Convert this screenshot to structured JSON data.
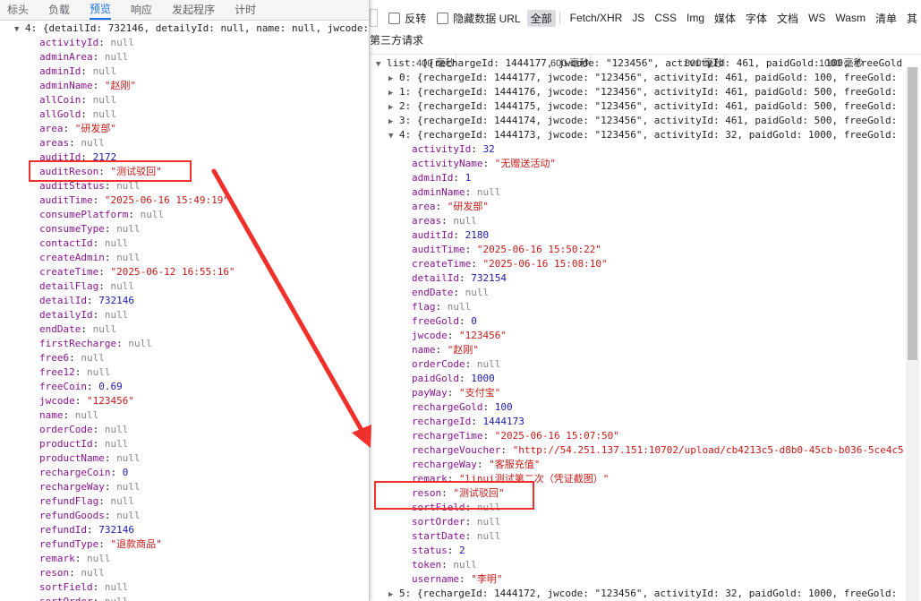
{
  "left_tabs": [
    {
      "label": "标头",
      "active": false
    },
    {
      "label": "负载",
      "active": false
    },
    {
      "label": "预览",
      "active": true
    },
    {
      "label": "响应",
      "active": false
    },
    {
      "label": "发起程序",
      "active": false
    },
    {
      "label": "计时",
      "active": false
    }
  ],
  "left_header": "4: {detailId: 732146, detailyId: null, name: null, jwcode: \"123456\"",
  "left_props": [
    {
      "k": "activityId",
      "v": "null",
      "t": "nul"
    },
    {
      "k": "adminArea",
      "v": "null",
      "t": "nul"
    },
    {
      "k": "adminId",
      "v": "null",
      "t": "nul"
    },
    {
      "k": "adminName",
      "v": "\"赵刚\"",
      "t": "str"
    },
    {
      "k": "allCoin",
      "v": "null",
      "t": "nul"
    },
    {
      "k": "allGold",
      "v": "null",
      "t": "nul"
    },
    {
      "k": "area",
      "v": "\"研发部\"",
      "t": "str"
    },
    {
      "k": "areas",
      "v": "null",
      "t": "nul"
    },
    {
      "k": "auditId",
      "v": "2172",
      "t": "num"
    },
    {
      "k": "auditReson",
      "v": "\"测试驳回\"",
      "t": "str"
    },
    {
      "k": "auditStatus",
      "v": "null",
      "t": "nul"
    },
    {
      "k": "auditTime",
      "v": "\"2025-06-16 15:49:19\"",
      "t": "str"
    },
    {
      "k": "consumePlatform",
      "v": "null",
      "t": "nul"
    },
    {
      "k": "consumeType",
      "v": "null",
      "t": "nul"
    },
    {
      "k": "contactId",
      "v": "null",
      "t": "nul"
    },
    {
      "k": "createAdmin",
      "v": "null",
      "t": "nul"
    },
    {
      "k": "createTime",
      "v": "\"2025-06-12 16:55:16\"",
      "t": "str"
    },
    {
      "k": "detailFlag",
      "v": "null",
      "t": "nul"
    },
    {
      "k": "detailId",
      "v": "732146",
      "t": "num"
    },
    {
      "k": "detailyId",
      "v": "null",
      "t": "nul"
    },
    {
      "k": "endDate",
      "v": "null",
      "t": "nul"
    },
    {
      "k": "firstRecharge",
      "v": "null",
      "t": "nul"
    },
    {
      "k": "free6",
      "v": "null",
      "t": "nul"
    },
    {
      "k": "free12",
      "v": "null",
      "t": "nul"
    },
    {
      "k": "freeCoin",
      "v": "0.69",
      "t": "num"
    },
    {
      "k": "jwcode",
      "v": "\"123456\"",
      "t": "str"
    },
    {
      "k": "name",
      "v": "null",
      "t": "nul"
    },
    {
      "k": "orderCode",
      "v": "null",
      "t": "nul"
    },
    {
      "k": "productId",
      "v": "null",
      "t": "nul"
    },
    {
      "k": "productName",
      "v": "null",
      "t": "nul"
    },
    {
      "k": "rechargeCoin",
      "v": "0",
      "t": "num"
    },
    {
      "k": "rechargeWay",
      "v": "null",
      "t": "nul"
    },
    {
      "k": "refundFlag",
      "v": "null",
      "t": "nul"
    },
    {
      "k": "refundGoods",
      "v": "null",
      "t": "nul"
    },
    {
      "k": "refundId",
      "v": "732146",
      "t": "num"
    },
    {
      "k": "refundType",
      "v": "\"退款商品\"",
      "t": "str"
    },
    {
      "k": "remark",
      "v": "null",
      "t": "nul"
    },
    {
      "k": "reson",
      "v": "null",
      "t": "nul"
    },
    {
      "k": "sortField",
      "v": "null",
      "t": "nul"
    },
    {
      "k": "sortOrder",
      "v": "null",
      "t": "nul"
    }
  ],
  "filter_bar": {
    "invert_label": "反转",
    "hide_data_url_label": "隐藏数据 URL",
    "types": [
      "全部",
      "Fetch/XHR",
      "JS",
      "CSS",
      "Img",
      "媒体",
      "字体",
      "文档",
      "WS",
      "Wasm",
      "清单",
      "其"
    ],
    "active_type": "全部"
  },
  "third_party_label": "第三方请求",
  "timeline_ticks": [
    "400 毫秒",
    "600 毫秒",
    "800 毫秒",
    "1000 毫秒",
    "1200 毫秒",
    "140"
  ],
  "right_list_header": "list: [{rechargeId: 1444177, jwcode: \"123456\", activityId: 461, paidGold: 100, freeGold:",
  "right_rows": [
    "0: {rechargeId: 1444177, jwcode: \"123456\", activityId: 461, paidGold: 100, freeGold: ",
    "1: {rechargeId: 1444176, jwcode: \"123456\", activityId: 461, paidGold: 500, freeGold: ",
    "2: {rechargeId: 1444175, jwcode: \"123456\", activityId: 461, paidGold: 500, freeGold: ",
    "3: {rechargeId: 1444174, jwcode: \"123456\", activityId: 461, paidGold: 500, freeGold: "
  ],
  "right_expanded_header": "4: {rechargeId: 1444173, jwcode: \"123456\", activityId: 32, paidGold: 1000, freeGold: ",
  "right_props": [
    {
      "k": "activityId",
      "v": "32",
      "t": "num"
    },
    {
      "k": "activityName",
      "v": "\"无赠送活动\"",
      "t": "str"
    },
    {
      "k": "adminId",
      "v": "1",
      "t": "num"
    },
    {
      "k": "adminName",
      "v": "null",
      "t": "nul"
    },
    {
      "k": "area",
      "v": "\"研发部\"",
      "t": "str"
    },
    {
      "k": "areas",
      "v": "null",
      "t": "nul"
    },
    {
      "k": "auditId",
      "v": "2180",
      "t": "num"
    },
    {
      "k": "auditTime",
      "v": "\"2025-06-16 15:50:22\"",
      "t": "str"
    },
    {
      "k": "createTime",
      "v": "\"2025-06-16 15:08:10\"",
      "t": "str"
    },
    {
      "k": "detailId",
      "v": "732154",
      "t": "num"
    },
    {
      "k": "endDate",
      "v": "null",
      "t": "nul"
    },
    {
      "k": "flag",
      "v": "null",
      "t": "nul"
    },
    {
      "k": "freeGold",
      "v": "0",
      "t": "num"
    },
    {
      "k": "jwcode",
      "v": "\"123456\"",
      "t": "str"
    },
    {
      "k": "name",
      "v": "\"赵刚\"",
      "t": "str"
    },
    {
      "k": "orderCode",
      "v": "null",
      "t": "nul"
    },
    {
      "k": "paidGold",
      "v": "1000",
      "t": "num"
    },
    {
      "k": "payWay",
      "v": "\"支付宝\"",
      "t": "str"
    },
    {
      "k": "rechargeGold",
      "v": "100",
      "t": "num"
    },
    {
      "k": "rechargeId",
      "v": "1444173",
      "t": "num"
    },
    {
      "k": "rechargeTime",
      "v": "\"2025-06-16 15:07:50\"",
      "t": "str"
    },
    {
      "k": "rechargeVoucher",
      "v": "\"http://54.251.137.151:10702/upload/cb4213c5-d8b0-45cb-b036-5ce4c54",
      "t": "str"
    },
    {
      "k": "rechargeWay",
      "v": "\"客服充值\"",
      "t": "str"
    },
    {
      "k": "remark",
      "v": "\"linui测试第二次（凭证截图）\"",
      "t": "str"
    },
    {
      "k": "reson",
      "v": "\"测试驳回\"",
      "t": "str"
    },
    {
      "k": "sortField",
      "v": "null",
      "t": "nul"
    },
    {
      "k": "sortOrder",
      "v": "null",
      "t": "nul"
    },
    {
      "k": "startDate",
      "v": "null",
      "t": "nul"
    },
    {
      "k": "status",
      "v": "2",
      "t": "num"
    },
    {
      "k": "token",
      "v": "null",
      "t": "nul"
    },
    {
      "k": "username",
      "v": "\"李明\"",
      "t": "str"
    }
  ],
  "right_footer": "5: {rechargeId: 1444172, jwcode: \"123456\", activityId: 32, paidGold: 1000, freeGold: ",
  "annotation_color": "#f0302a"
}
